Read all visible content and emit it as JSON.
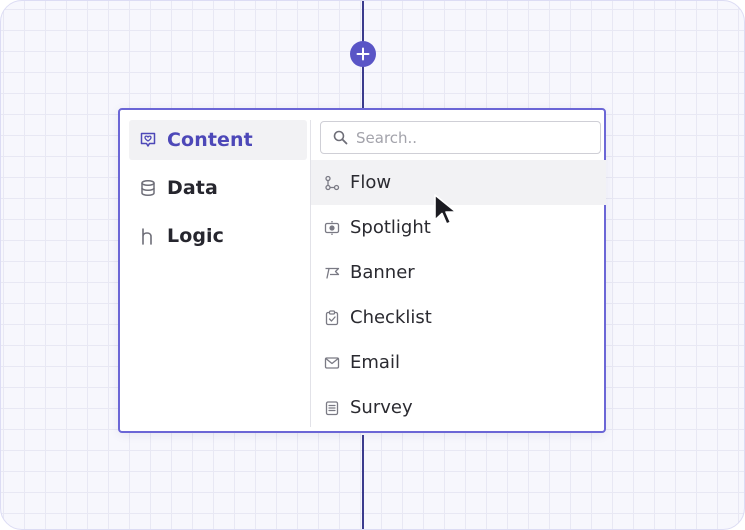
{
  "categories": [
    {
      "label": "Content",
      "icon": "heart-chat-icon",
      "active": true
    },
    {
      "label": "Data",
      "icon": "database-icon",
      "active": false
    },
    {
      "label": "Logic",
      "icon": "branch-logic-icon",
      "active": false
    }
  ],
  "search": {
    "placeholder": "Search..",
    "value": ""
  },
  "items": [
    {
      "label": "Flow",
      "icon": "flow-icon"
    },
    {
      "label": "Spotlight",
      "icon": "spotlight-icon"
    },
    {
      "label": "Banner",
      "icon": "banner-flag-icon"
    },
    {
      "label": "Checklist",
      "icon": "checklist-icon"
    },
    {
      "label": "Email",
      "icon": "envelope-icon"
    },
    {
      "label": "Survey",
      "icon": "survey-icon"
    }
  ],
  "colors": {
    "accent": "#5a55c6",
    "border": "#6b66d6",
    "connector": "#3b3b8e",
    "hover_bg": "#f2f2f4"
  }
}
